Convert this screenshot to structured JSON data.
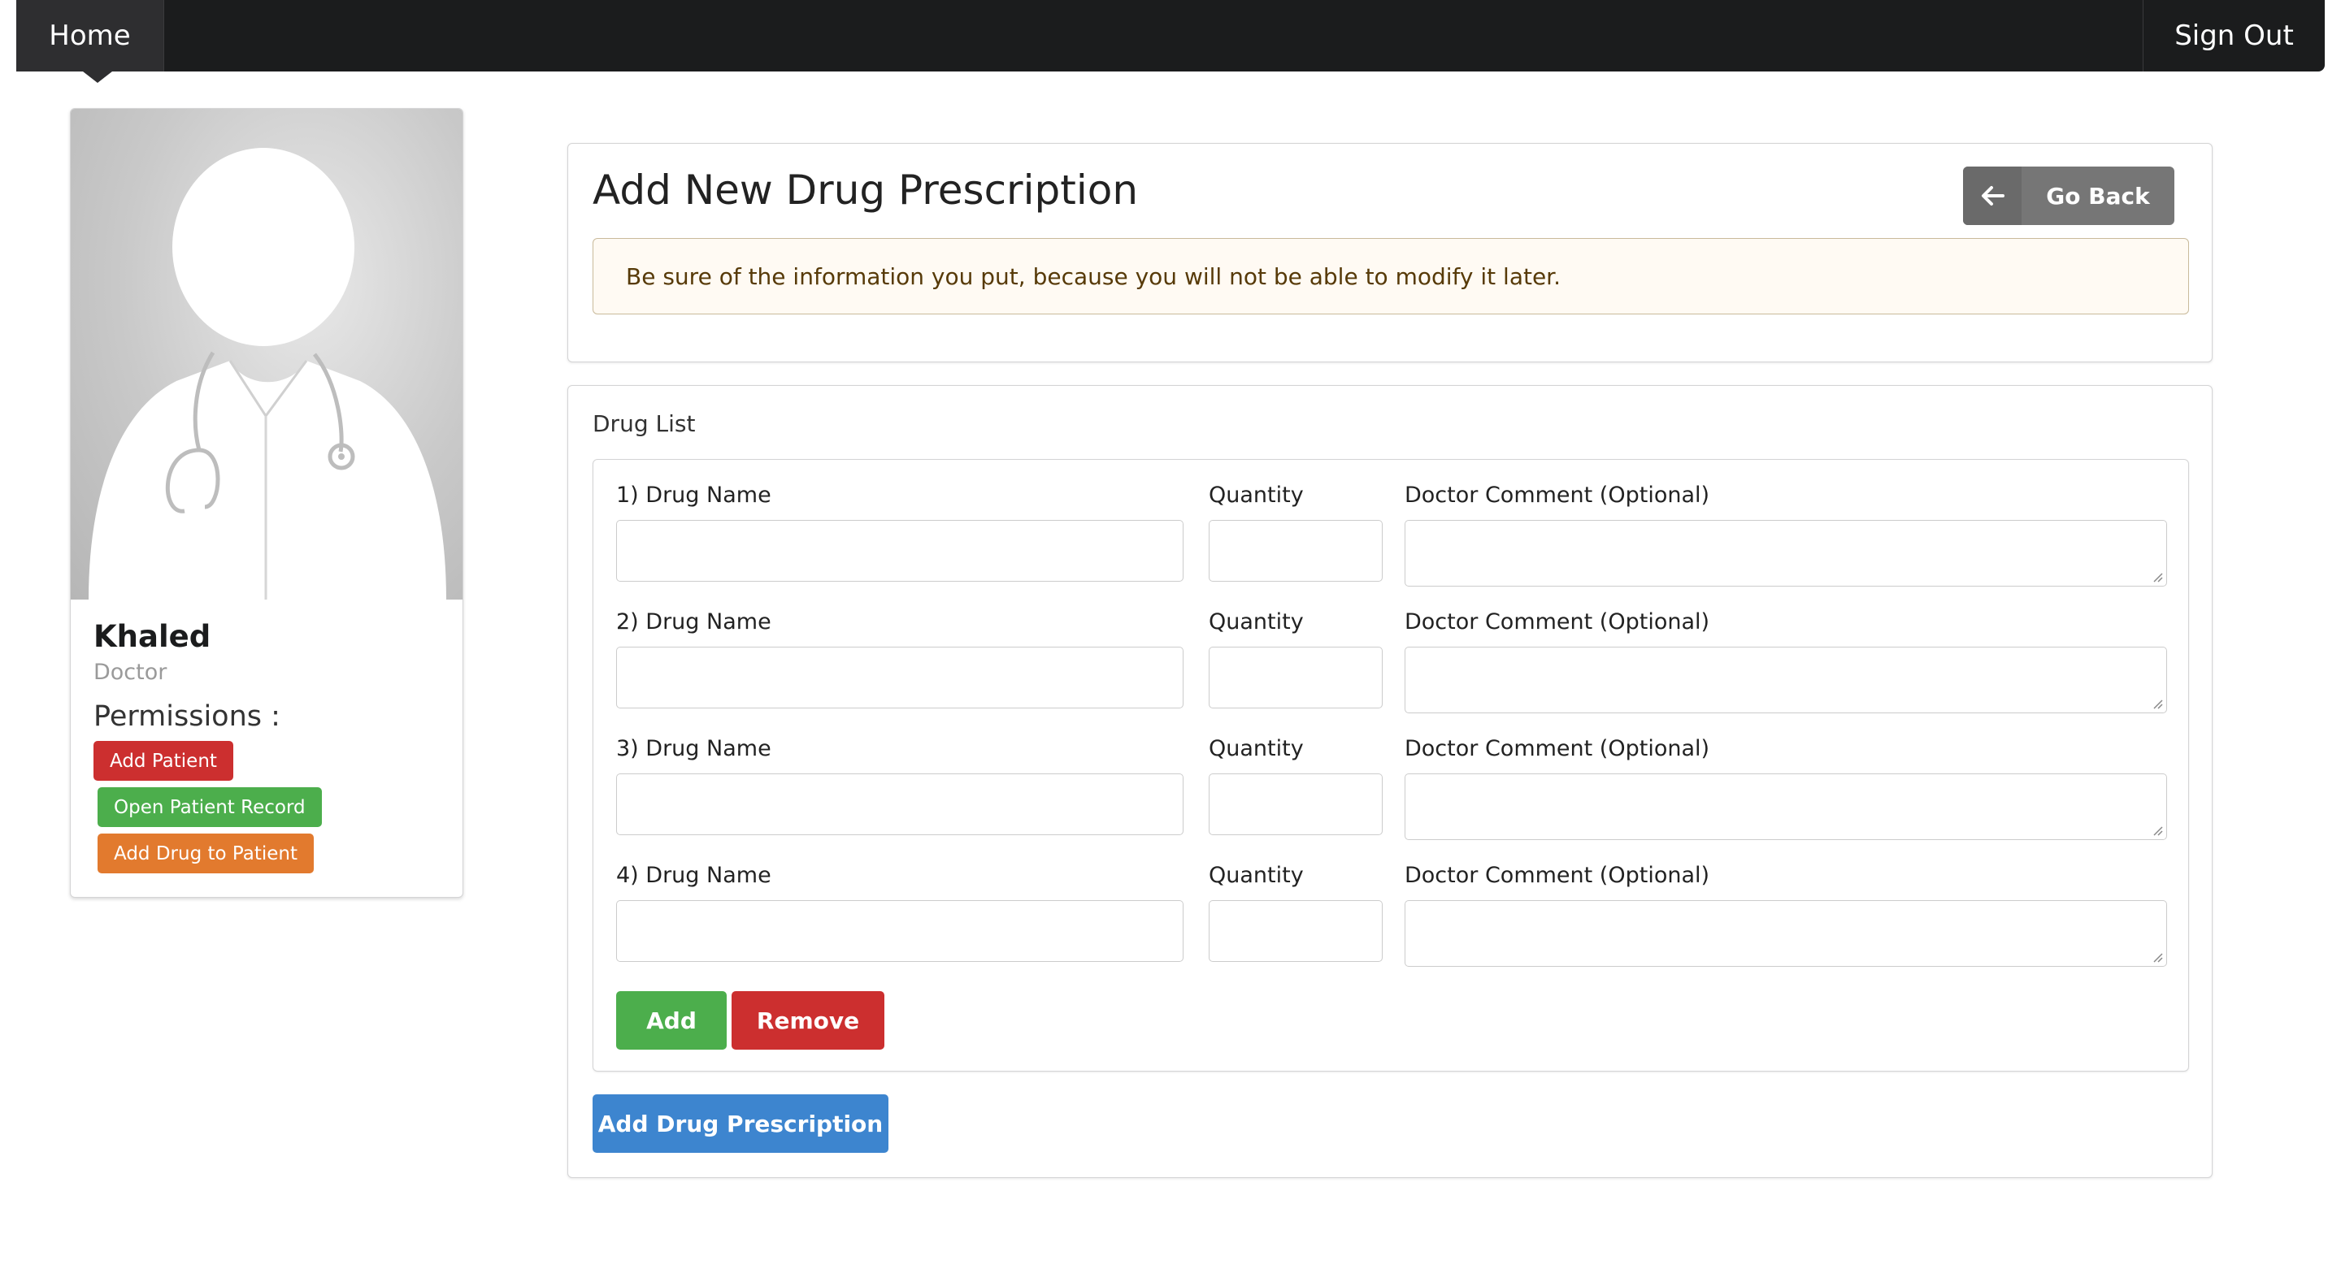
{
  "navbar": {
    "home_label": "Home",
    "signout_label": "Sign Out"
  },
  "profile": {
    "avatar_icon": "doctor-avatar",
    "name": "Khaled",
    "role": "Doctor",
    "permissions_title": "Permissions :",
    "permissions": [
      {
        "label": "Add Patient",
        "color": "#cc2f2f"
      },
      {
        "label": "Open Patient Record",
        "color": "#4cae4c"
      },
      {
        "label": "Add Drug to Patient",
        "color": "#e27a2e"
      }
    ]
  },
  "header": {
    "title": "Add New Drug Prescription",
    "go_back_label": "Go Back",
    "go_back_icon": "arrow-left-icon",
    "warning": "Be sure of the information you put, because you will not be able to modify it later."
  },
  "form": {
    "section_label": "Drug List",
    "rows": [
      {
        "name_label": "1) Drug Name",
        "qty_label": "Quantity",
        "comment_label": "Doctor Comment (Optional)",
        "name_value": "",
        "qty_value": "",
        "comment_value": ""
      },
      {
        "name_label": "2) Drug Name",
        "qty_label": "Quantity",
        "comment_label": "Doctor Comment (Optional)",
        "name_value": "",
        "qty_value": "",
        "comment_value": ""
      },
      {
        "name_label": "3) Drug Name",
        "qty_label": "Quantity",
        "comment_label": "Doctor Comment (Optional)",
        "name_value": "",
        "qty_value": "",
        "comment_value": ""
      },
      {
        "name_label": "4) Drug Name",
        "qty_label": "Quantity",
        "comment_label": "Doctor Comment (Optional)",
        "name_value": "",
        "qty_value": "",
        "comment_value": ""
      }
    ],
    "add_label": "Add",
    "remove_label": "Remove",
    "submit_label": "Add Drug Prescription"
  },
  "colors": {
    "navbar_bg": "#1b1c1d",
    "success": "#4cae4c",
    "danger": "#cc2f2f",
    "warning_orange": "#e27a2e",
    "primary": "#3d85cf",
    "grey_button": "#767676"
  }
}
